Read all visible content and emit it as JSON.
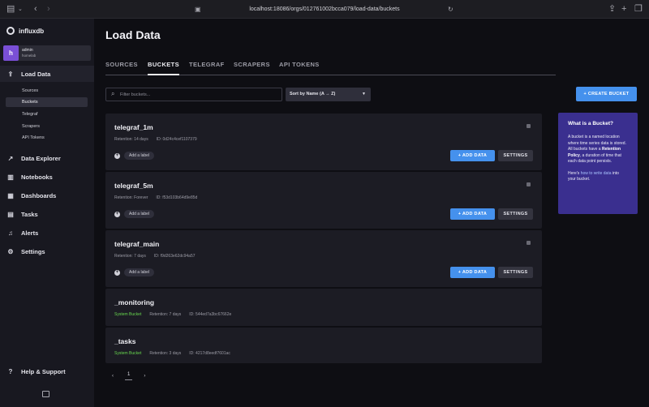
{
  "browser": {
    "url": "localhost:18086/orgs/012761002bcca079/load-data/buckets"
  },
  "sidebar": {
    "logo": "influxdb",
    "user": {
      "initial": "h",
      "name": "admin",
      "org": "homelab"
    },
    "nav": {
      "load_data": "Load Data",
      "data_explorer": "Data Explorer",
      "notebooks": "Notebooks",
      "dashboards": "Dashboards",
      "tasks": "Tasks",
      "alerts": "Alerts",
      "settings": "Settings",
      "help": "Help & Support"
    },
    "sub_items": [
      "Sources",
      "Buckets",
      "Telegraf",
      "Scrapers",
      "API Tokens"
    ]
  },
  "main": {
    "title": "Load Data",
    "tabs": [
      "SOURCES",
      "BUCKETS",
      "TELEGRAF",
      "SCRAPERS",
      "API TOKENS"
    ],
    "filter_placeholder": "Filter buckets...",
    "sort_label": "Sort by Name (A → Z)",
    "create_label": "+ CREATE BUCKET",
    "add_label": "Add a label",
    "add_data_label": "+ ADD DATA",
    "settings_label": "SETTINGS",
    "buckets": [
      {
        "name": "telegraf_1m",
        "retention": "Retention: 14 days",
        "id": "ID: 0d24c4cef1107379"
      },
      {
        "name": "telegraf_5m",
        "retention": "Retention: Forever",
        "id": "ID: f53d103b64d9e85d"
      },
      {
        "name": "telegraf_main",
        "retention": "Retention: 7 days",
        "id": "ID: f9d263e62dc94a57"
      },
      {
        "name": "_monitoring",
        "system": "System Bucket",
        "retention": "Retention: 7 days",
        "id": "ID: 544ed7a3bc67662e"
      },
      {
        "name": "_tasks",
        "system": "System Bucket",
        "retention": "Retention: 3 days",
        "id": "ID: 4217d8eedf7601ac"
      }
    ],
    "info": {
      "title": "What is a Bucket?",
      "p1_a": "A bucket is a named location where time series data is stored. All buckets have a ",
      "p1_b": "Retention Policy",
      "p1_c": ", a duration of time that each data point persists.",
      "p2_a": "Here's ",
      "p2_link": "how to write data",
      "p2_b": " into your bucket."
    },
    "pager": {
      "prev": "‹",
      "page": "1",
      "next": "›"
    }
  }
}
